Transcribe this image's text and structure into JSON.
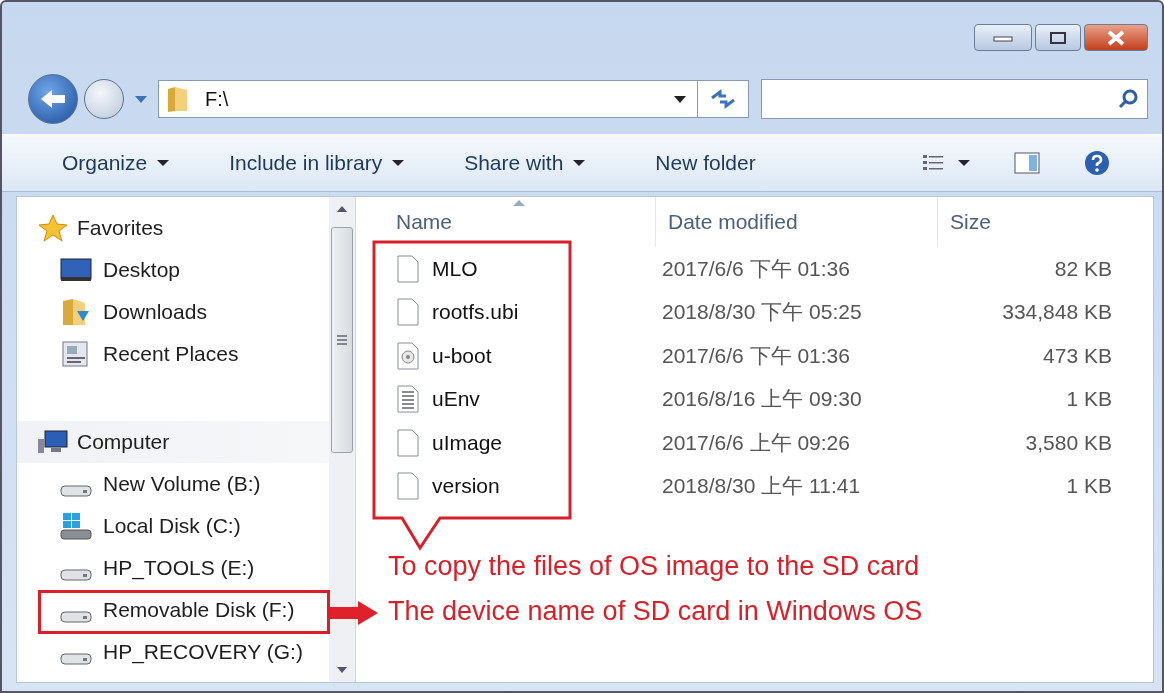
{
  "address": {
    "path": "F:\\"
  },
  "toolbar": {
    "items": [
      {
        "label": "Organize",
        "kind": "menu"
      },
      {
        "label": "Include in library",
        "kind": "menu"
      },
      {
        "label": "Share with",
        "kind": "menu"
      },
      {
        "label": "New folder",
        "kind": "plain"
      }
    ]
  },
  "sidebar": {
    "groups": [
      {
        "label": "Favorites",
        "items": [
          {
            "label": "Desktop"
          },
          {
            "label": "Downloads"
          },
          {
            "label": "Recent Places"
          }
        ]
      },
      {
        "label": "Computer",
        "items": [
          {
            "label": "New Volume (B:)"
          },
          {
            "label": "Local Disk (C:)"
          },
          {
            "label": "HP_TOOLS (E:)"
          },
          {
            "label": "Removable Disk (F:)"
          },
          {
            "label": "HP_RECOVERY (G:)"
          }
        ]
      }
    ]
  },
  "table": {
    "columns": [
      {
        "label": "Name",
        "sorted": true
      },
      {
        "label": "Date modified",
        "sorted": false
      },
      {
        "label": "Size",
        "sorted": false
      }
    ],
    "rows": [
      {
        "name": "MLO",
        "kind": "blank",
        "date": "2017/6/6 下午 01:36",
        "size": "82 KB"
      },
      {
        "name": "rootfs.ubi",
        "kind": "blank",
        "date": "2018/8/30 下午 05:25",
        "size": "334,848 KB"
      },
      {
        "name": "u-boot",
        "kind": "disc",
        "date": "2017/6/6 下午 01:36",
        "size": "473 KB"
      },
      {
        "name": "uEnv",
        "kind": "text",
        "date": "2016/8/16 上午 09:30",
        "size": "1 KB"
      },
      {
        "name": "uImage",
        "kind": "blank",
        "date": "2017/6/6 上午 09:26",
        "size": "3,580 KB"
      },
      {
        "name": "version",
        "kind": "blank",
        "date": "2018/8/30 上午 11:41",
        "size": "1 KB"
      }
    ]
  },
  "annotations": [
    {
      "kind": "callout",
      "text": "To copy the files of OS image to the SD card"
    },
    {
      "kind": "arrow",
      "text": "The device name of SD card in Windows OS"
    }
  ]
}
